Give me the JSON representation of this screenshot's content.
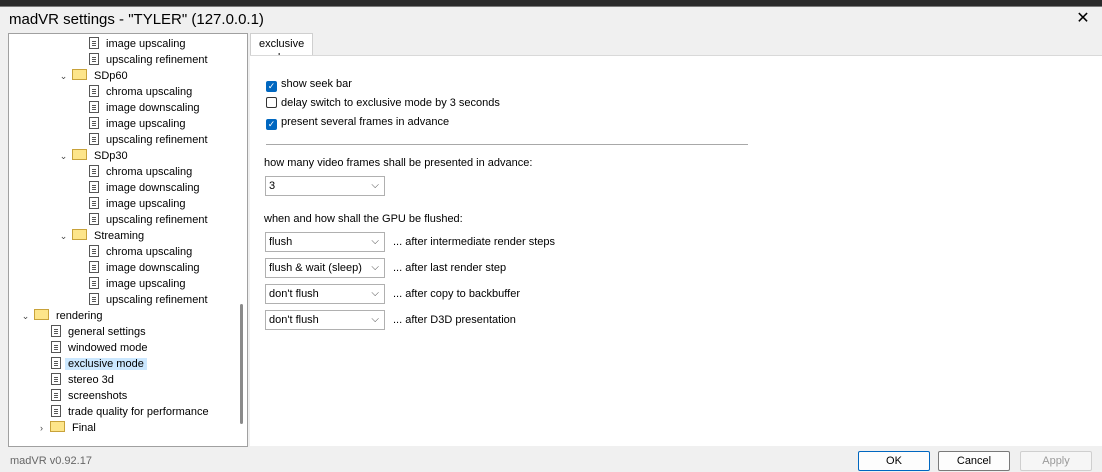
{
  "window": {
    "title": "madVR settings - \"TYLER\" (127.0.0.1)",
    "close_glyph": "✕"
  },
  "tree": [
    {
      "label": "image upscaling",
      "icon": "page"
    },
    {
      "label": "upscaling refinement",
      "icon": "page"
    },
    {
      "label": "SDp60",
      "icon": "folder"
    },
    {
      "label": "chroma upscaling",
      "icon": "page"
    },
    {
      "label": "image downscaling",
      "icon": "page"
    },
    {
      "label": "image upscaling",
      "icon": "page"
    },
    {
      "label": "upscaling refinement",
      "icon": "page"
    },
    {
      "label": "SDp30",
      "icon": "folder"
    },
    {
      "label": "chroma upscaling",
      "icon": "page"
    },
    {
      "label": "image downscaling",
      "icon": "page"
    },
    {
      "label": "image upscaling",
      "icon": "page"
    },
    {
      "label": "upscaling refinement",
      "icon": "page"
    },
    {
      "label": "Streaming",
      "icon": "folder"
    },
    {
      "label": "chroma upscaling",
      "icon": "page"
    },
    {
      "label": "image downscaling",
      "icon": "page"
    },
    {
      "label": "image upscaling",
      "icon": "page"
    },
    {
      "label": "upscaling refinement",
      "icon": "page"
    },
    {
      "label": "rendering",
      "icon": "folder"
    },
    {
      "label": "general settings",
      "icon": "page"
    },
    {
      "label": "windowed mode",
      "icon": "page"
    },
    {
      "label": "exclusive mode",
      "icon": "page",
      "selected": true
    },
    {
      "label": "stereo 3d",
      "icon": "page"
    },
    {
      "label": "screenshots",
      "icon": "page"
    },
    {
      "label": "trade quality for performance",
      "icon": "page"
    },
    {
      "label": "Final",
      "icon": "folder"
    }
  ],
  "tab": {
    "label": "exclusive mode"
  },
  "options": {
    "show_seek_bar": {
      "label": "show seek bar",
      "checked": true
    },
    "delay_switch": {
      "label": "delay switch to exclusive mode by 3 seconds",
      "checked": false
    },
    "present_frames": {
      "label": "present several frames in advance",
      "checked": true
    }
  },
  "frames": {
    "label": "how many video frames shall be presented in advance:",
    "value": "3"
  },
  "flush": {
    "label": "when and how shall the GPU be flushed:",
    "rows": [
      {
        "value": "flush",
        "after": "... after intermediate render steps"
      },
      {
        "value": "flush & wait (sleep)",
        "after": "... after last render step"
      },
      {
        "value": "don't flush",
        "after": "... after copy to backbuffer"
      },
      {
        "value": "don't flush",
        "after": "... after D3D presentation"
      }
    ]
  },
  "footer": {
    "version": "madVR v0.92.17",
    "ok": "OK",
    "cancel": "Cancel",
    "apply": "Apply"
  }
}
